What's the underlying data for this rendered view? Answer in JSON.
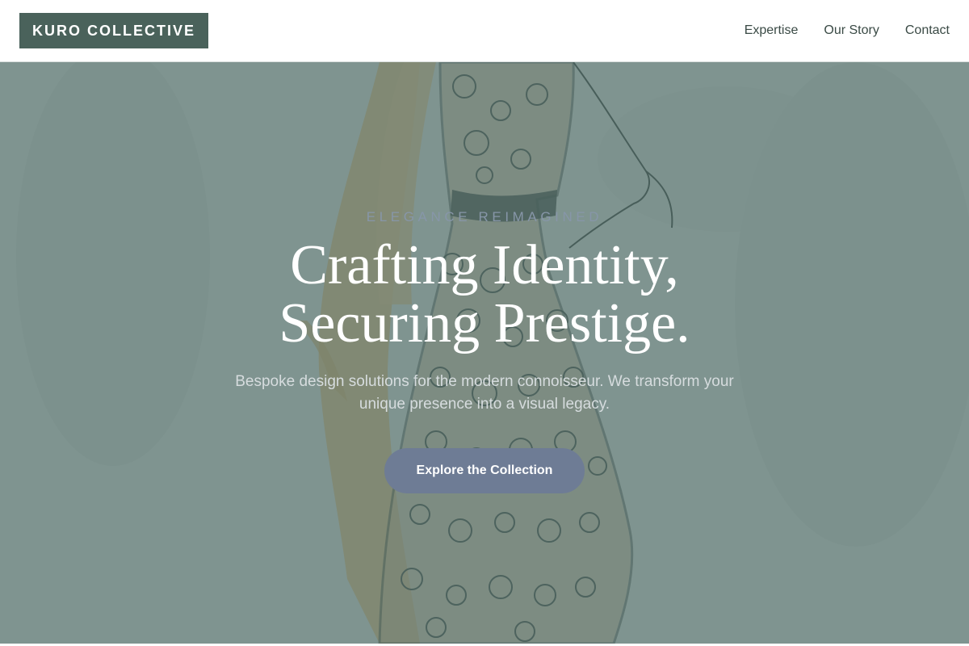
{
  "header": {
    "brand": "KURO COLLECTIVE",
    "nav": [
      {
        "label": "Expertise"
      },
      {
        "label": "Our Story"
      },
      {
        "label": "Contact"
      }
    ]
  },
  "hero": {
    "eyebrow": "ELEGANCE REIMAGINED",
    "headline_line1": "Crafting Identity,",
    "headline_line2": "Securing Prestige.",
    "subtext": "Bespoke design solutions for the modern connoisseur. We transform your unique presence into a visual legacy.",
    "cta_label": "Explore the Collection",
    "background_image": "fashion-sketch-dress"
  },
  "colors": {
    "brand_bg": "#4a625b",
    "overlay": "#56706c",
    "cta_bg": "#6e7c95",
    "nav_text": "#3a4a45"
  }
}
